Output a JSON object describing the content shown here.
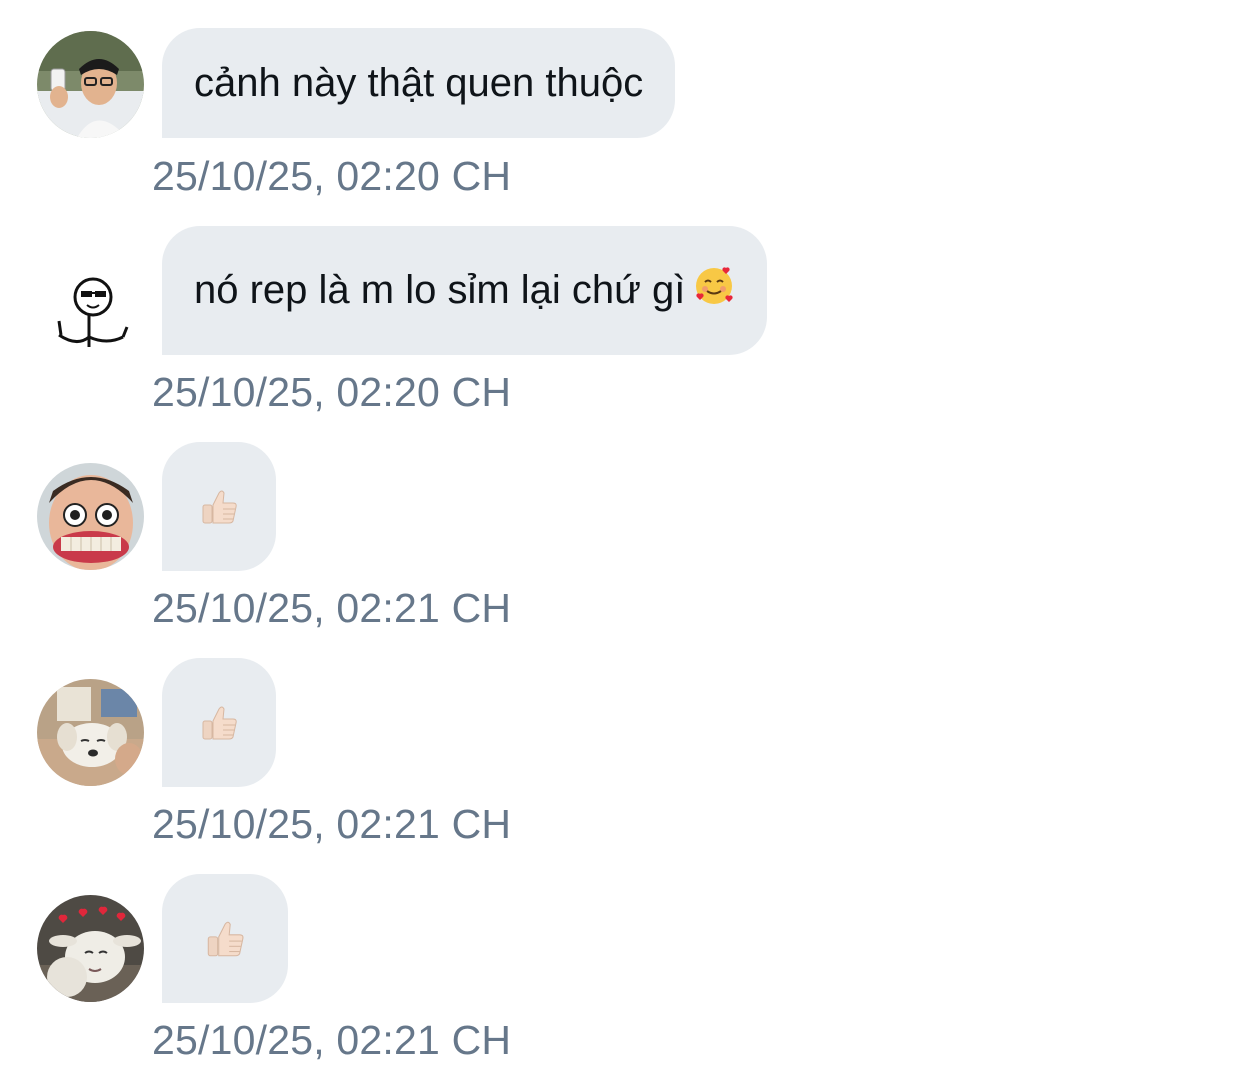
{
  "messages": [
    {
      "avatar_icon": "avatar-boy-glasses",
      "text": "cảnh này thật quen thuộc",
      "timestamp": "25/10/25, 02:20 CH"
    },
    {
      "avatar_icon": "avatar-stick-figure-sunglasses",
      "text": "nó rep là m lo sỉm lại chứ gì",
      "emoji": "smiling-face-with-hearts-icon",
      "timestamp": "25/10/25, 02:20 CH"
    },
    {
      "avatar_icon": "avatar-funny-face",
      "emoji": "thumbs-up-icon",
      "timestamp": "25/10/25, 02:21 CH"
    },
    {
      "avatar_icon": "avatar-puppy",
      "emoji": "thumbs-up-icon",
      "timestamp": "25/10/25, 02:21 CH"
    },
    {
      "avatar_icon": "avatar-goat-hearts",
      "emoji": "thumbs-up-icon",
      "timestamp": "25/10/25, 02:21 CH"
    }
  ],
  "colors": {
    "bubble_bg": "#e8ecf0",
    "text": "#0f1419",
    "timestamp": "#66778a",
    "skin_tone": "#f5dccb"
  }
}
